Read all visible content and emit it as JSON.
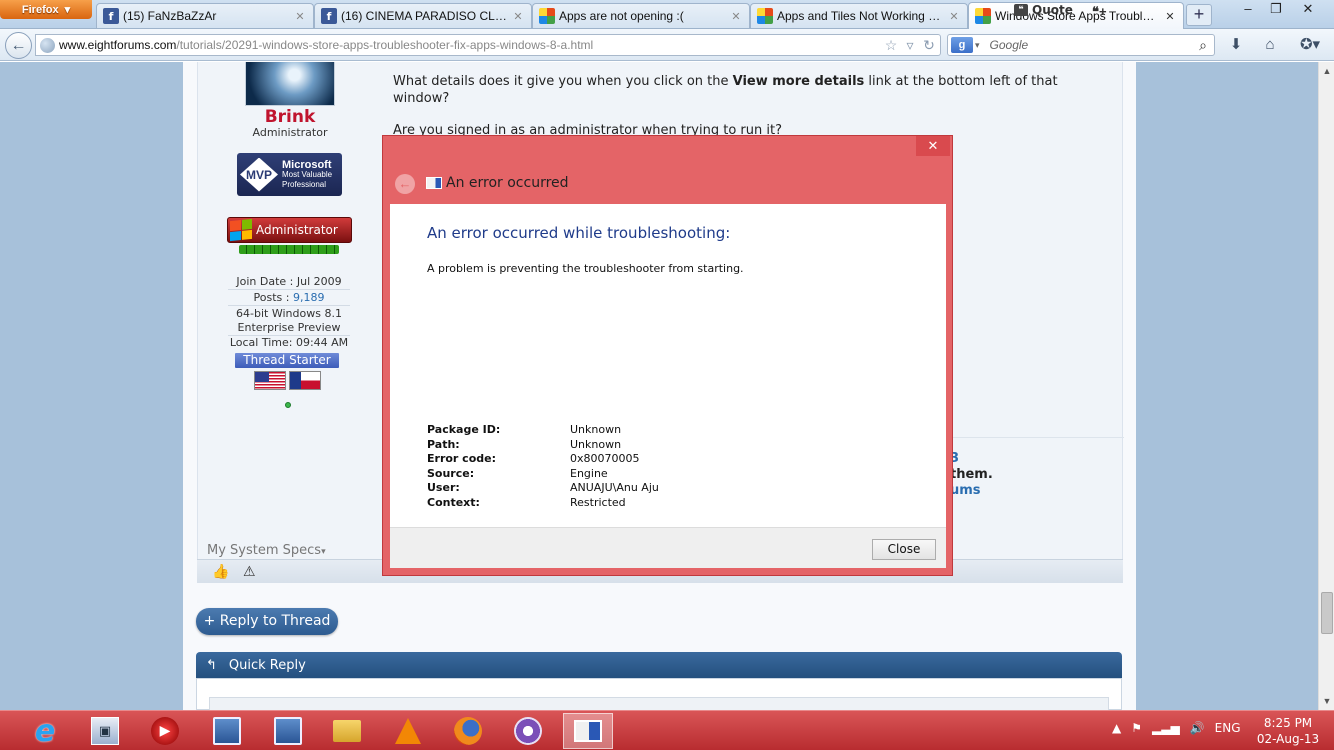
{
  "browser": {
    "menu_label": "Firefox",
    "tabs": [
      {
        "title": "(15) FaNzBaZzAr",
        "icon": "facebook-icon"
      },
      {
        "title": "(16) CINEMA PARADISO CLUB",
        "icon": "facebook-icon"
      },
      {
        "title": "Apps are not opening :(",
        "icon": "eightforums-icon"
      },
      {
        "title": "Apps and Tiles Not Working or ...",
        "icon": "eightforums-icon"
      },
      {
        "title": "Windows Store Apps Troublesh...",
        "icon": "eightforums-icon",
        "active": true
      }
    ],
    "url_domain": "www.eightforums.com",
    "url_path": "/tutorials/20291-windows-store-apps-troubleshooter-fix-apps-windows-8-a.html",
    "search_engine": "g",
    "search_placeholder": "Google"
  },
  "profile": {
    "name": "Brink",
    "role": "Administrator",
    "mvp_line1": "Microsoft",
    "mvp_line2": "Most Valuable",
    "mvp_line3": "Professional",
    "admin_badge": "Administrator",
    "join_date_label": "Join Date : Jul 2009",
    "posts_label": "Posts : ",
    "posts_value": "9,189",
    "os_line1": "64-bit Windows 8.1",
    "os_line2": "Enterprise Preview",
    "local_time": "Local Time: 09:44 AM",
    "thread_starter": "Thread Starter"
  },
  "post": {
    "q1_pre": "What details does it give you when you click on the ",
    "q1_bold": "View more details",
    "q1_post": " link at the bottom left of that window?",
    "q2": "Are you signed in as an administrator when trying to run it?",
    "sig_fragments": [
      "3",
      "them.",
      "ums"
    ],
    "system_specs": "My System Specs",
    "quote_label": "Quote",
    "reply_thread": "+ Reply to Thread",
    "quick_reply": "Quick Reply"
  },
  "dialog": {
    "title": "An error occurred",
    "heading": "An error occurred while troubleshooting:",
    "message": "A problem is preventing the troubleshooter from starting.",
    "details": [
      {
        "key": "Package ID:",
        "value": "Unknown"
      },
      {
        "key": "Path:",
        "value": "Unknown"
      },
      {
        "key": "Error code:",
        "value": "0x80070005"
      },
      {
        "key": "Source:",
        "value": "Engine"
      },
      {
        "key": "User:",
        "value": "ANUAJU\\Anu Aju"
      },
      {
        "key": "Context:",
        "value": "Restricted"
      }
    ],
    "close_button": "Close"
  },
  "taskbar": {
    "language": "ENG",
    "time": "8:25 PM",
    "date": "02-Aug-13"
  },
  "colors": {
    "dialog_frame": "#e46467",
    "taskbar": "#c93e41",
    "page_background": "#a7c1da",
    "dialog_heading": "#1f3b8a",
    "username": "#c0142e"
  }
}
